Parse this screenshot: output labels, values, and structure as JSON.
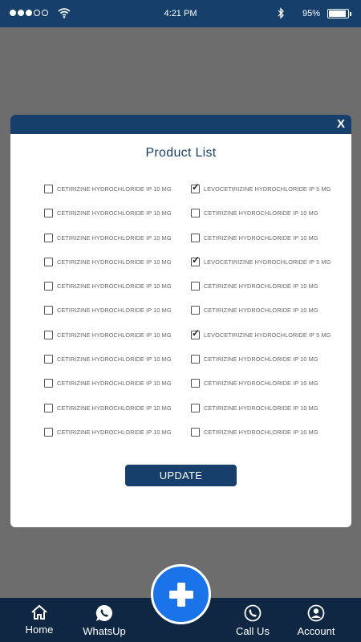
{
  "status_bar": {
    "time": "4:21 PM",
    "battery_percent": "95%",
    "icons": [
      "signal-dots-icon",
      "wifi-icon",
      "bluetooth-icon",
      "battery-icon"
    ]
  },
  "modal": {
    "title": "Product List",
    "close_label": "X",
    "update_label": "UPDATE",
    "products": [
      [
        {
          "label": "CETIRIZINE HYDROCHLORIDE IP 10 MG",
          "checked": false
        },
        {
          "label": "LEVOCETIRIZINE HYDROCHLORIDE IP 5 MG",
          "checked": true
        }
      ],
      [
        {
          "label": "CETIRIZINE HYDROCHLORIDE IP 10 MG",
          "checked": false
        },
        {
          "label": "CETIRIZINE HYDROCHLORIDE IP 10 MG",
          "checked": false
        }
      ],
      [
        {
          "label": "CETIRIZINE HYDROCHLORIDE IP 10 MG",
          "checked": false
        },
        {
          "label": "CETIRIZINE HYDROCHLORIDE IP 10 MG",
          "checked": false
        }
      ],
      [
        {
          "label": "CETIRIZINE HYDROCHLORIDE IP 10 MG",
          "checked": false
        },
        {
          "label": "LEVOCETIRIZINE HYDROCHLORIDE IP 5 MG",
          "checked": true
        }
      ],
      [
        {
          "label": "CETIRIZINE HYDROCHLORIDE IP 10 MG",
          "checked": false
        },
        {
          "label": "CETIRIZINE HYDROCHLORIDE IP 10 MG",
          "checked": false
        }
      ],
      [
        {
          "label": "CETIRIZINE HYDROCHLORIDE IP 10 MG",
          "checked": false
        },
        {
          "label": "CETIRIZINE HYDROCHLORIDE IP 10 MG",
          "checked": false
        }
      ],
      [
        {
          "label": "CETIRIZINE HYDROCHLORIDE IP 10 MG",
          "checked": false
        },
        {
          "label": "LEVOCETIRIZINE HYDROCHLORIDE IP 5 MG",
          "checked": true
        }
      ],
      [
        {
          "label": "CETIRIZINE HYDROCHLORIDE IP 10 MG",
          "checked": false
        },
        {
          "label": "CETIRIZINE HYDROCHLORIDE IP 10 MG",
          "checked": false
        }
      ],
      [
        {
          "label": "CETIRIZINE HYDROCHLORIDE IP 10 MG",
          "checked": false
        },
        {
          "label": "CETIRIZINE HYDROCHLORIDE IP 10 MG",
          "checked": false
        }
      ],
      [
        {
          "label": "CETIRIZINE HYDROCHLORIDE IP 10 MG",
          "checked": false
        },
        {
          "label": "CETIRIZINE HYDROCHLORIDE IP 10 MG",
          "checked": false
        }
      ],
      [
        {
          "label": "CETIRIZINE HYDROCHLORIDE IP 10 MG",
          "checked": false
        },
        {
          "label": "CETIRIZINE HYDROCHLORIDE IP 10 MG",
          "checked": false
        }
      ]
    ]
  },
  "bottom_nav": {
    "items": [
      {
        "label": "Home",
        "icon": "home-icon"
      },
      {
        "label": "WhatsUp",
        "icon": "whatsapp-icon"
      },
      {
        "label": "Call Us",
        "icon": "phone-icon"
      },
      {
        "label": "Account",
        "icon": "account-icon"
      }
    ],
    "fab_icon": "plus-icon"
  },
  "colors": {
    "primary": "#163f6b",
    "nav_background": "#0f2742",
    "fab": "#1a73e8",
    "title_text": "#1d3f66"
  }
}
